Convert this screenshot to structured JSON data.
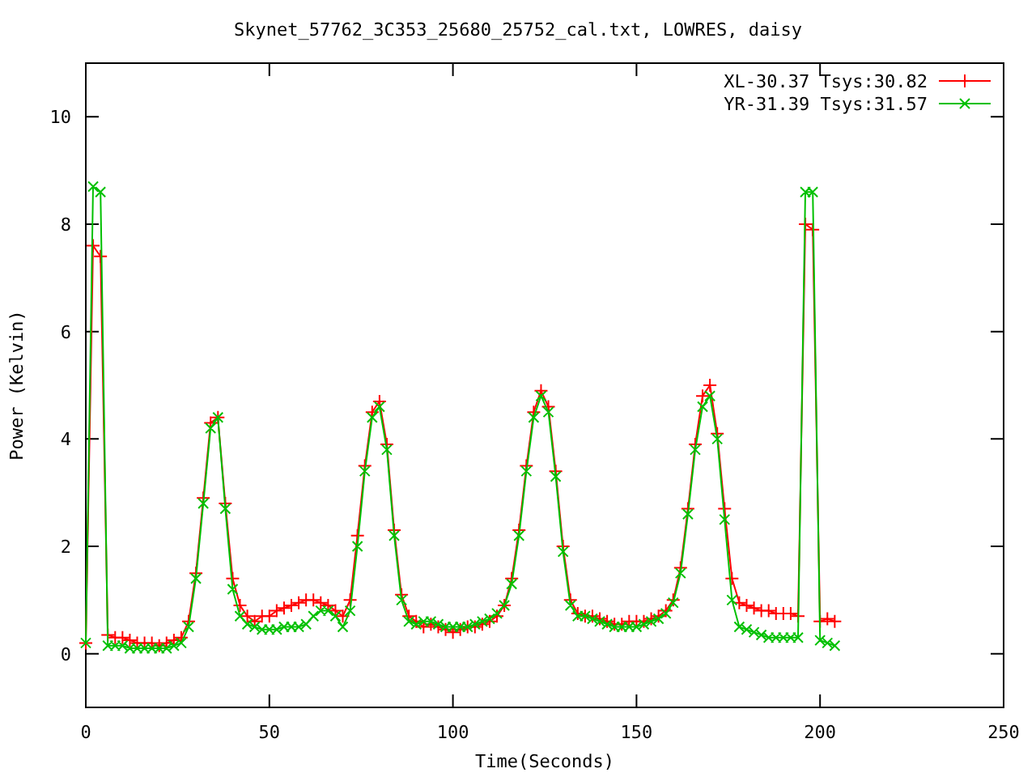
{
  "chart_data": {
    "type": "line",
    "title": "Skynet_57762_3C353_25680_25752_cal.txt, LOWRES, daisy",
    "xlabel": "Time(Seconds)",
    "ylabel": "Power (Kelvin)",
    "x": [
      0,
      2,
      4,
      6,
      8,
      10,
      12,
      14,
      16,
      18,
      20,
      22,
      24,
      26,
      28,
      30,
      32,
      34,
      36,
      38,
      40,
      42,
      44,
      46,
      48,
      50,
      52,
      54,
      56,
      58,
      60,
      62,
      64,
      66,
      68,
      70,
      72,
      74,
      76,
      78,
      80,
      82,
      84,
      86,
      88,
      90,
      92,
      94,
      96,
      98,
      100,
      102,
      104,
      106,
      108,
      110,
      112,
      114,
      116,
      118,
      120,
      122,
      124,
      126,
      128,
      130,
      132,
      134,
      136,
      138,
      140,
      142,
      144,
      146,
      148,
      150,
      152,
      154,
      156,
      158,
      160,
      162,
      164,
      166,
      168,
      170,
      172,
      174,
      176,
      178,
      180,
      182,
      184,
      186,
      188,
      190,
      192,
      194,
      196,
      198,
      200,
      202,
      204
    ],
    "series": [
      {
        "name": "XL-30.37 Tsys:30.82",
        "color": "#ff0000",
        "marker": "plus",
        "values": [
          0.2,
          7.6,
          7.4,
          0.35,
          0.3,
          0.3,
          0.25,
          0.2,
          0.2,
          0.2,
          0.15,
          0.2,
          0.25,
          0.3,
          0.6,
          1.5,
          2.9,
          4.3,
          4.4,
          2.8,
          1.4,
          0.9,
          0.7,
          0.6,
          0.7,
          0.7,
          0.8,
          0.85,
          0.9,
          0.95,
          1.0,
          1.0,
          0.95,
          0.9,
          0.8,
          0.7,
          1.0,
          2.2,
          3.5,
          4.5,
          4.7,
          3.9,
          2.3,
          1.1,
          0.7,
          0.6,
          0.5,
          0.55,
          0.5,
          0.45,
          0.4,
          0.45,
          0.5,
          0.5,
          0.55,
          0.6,
          0.7,
          0.9,
          1.4,
          2.3,
          3.5,
          4.5,
          4.9,
          4.6,
          3.4,
          2.0,
          1.0,
          0.75,
          0.7,
          0.7,
          0.65,
          0.6,
          0.55,
          0.55,
          0.6,
          0.6,
          0.6,
          0.65,
          0.7,
          0.8,
          1.0,
          1.6,
          2.7,
          3.9,
          4.8,
          5.0,
          4.1,
          2.7,
          1.4,
          0.95,
          0.9,
          0.85,
          0.8,
          0.8,
          0.75,
          0.75,
          0.75,
          0.7,
          8.0,
          7.9,
          0.6,
          0.65,
          0.6
        ]
      },
      {
        "name": "YR-31.39 Tsys:31.57",
        "color": "#00c000",
        "marker": "cross",
        "values": [
          0.2,
          8.7,
          8.6,
          0.15,
          0.15,
          0.15,
          0.1,
          0.1,
          0.1,
          0.1,
          0.1,
          0.1,
          0.15,
          0.2,
          0.5,
          1.4,
          2.8,
          4.2,
          4.4,
          2.7,
          1.2,
          0.7,
          0.55,
          0.5,
          0.45,
          0.45,
          0.45,
          0.5,
          0.5,
          0.5,
          0.55,
          0.7,
          0.8,
          0.8,
          0.7,
          0.5,
          0.8,
          2.0,
          3.4,
          4.4,
          4.6,
          3.8,
          2.2,
          1.0,
          0.6,
          0.55,
          0.6,
          0.6,
          0.55,
          0.5,
          0.5,
          0.5,
          0.5,
          0.55,
          0.6,
          0.65,
          0.75,
          0.9,
          1.3,
          2.2,
          3.4,
          4.4,
          4.8,
          4.5,
          3.3,
          1.9,
          0.9,
          0.7,
          0.7,
          0.65,
          0.6,
          0.55,
          0.5,
          0.5,
          0.5,
          0.5,
          0.55,
          0.6,
          0.65,
          0.75,
          0.95,
          1.5,
          2.6,
          3.8,
          4.6,
          4.8,
          4.0,
          2.5,
          1.0,
          0.5,
          0.45,
          0.4,
          0.35,
          0.3,
          0.3,
          0.3,
          0.3,
          0.3,
          8.6,
          8.6,
          0.25,
          0.2,
          0.15
        ]
      }
    ],
    "legend": "upper right",
    "xlim": [
      0,
      250
    ],
    "ylim": [
      -1,
      11
    ],
    "xticks": [
      0,
      50,
      100,
      150,
      200,
      250
    ],
    "yticks": [
      0,
      2,
      4,
      6,
      8,
      10
    ]
  }
}
